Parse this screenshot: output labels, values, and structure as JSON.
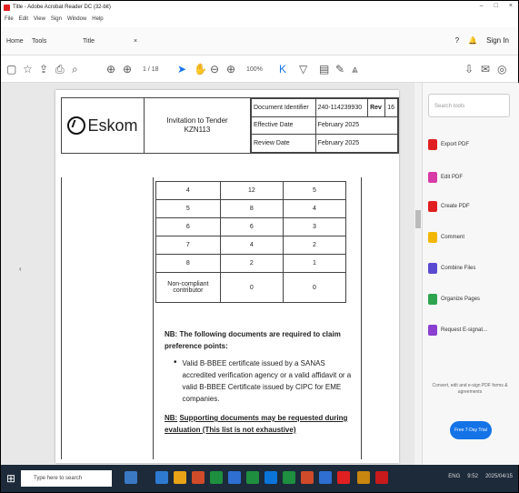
{
  "window": {
    "title": "Title - Adobe Acrobat Reader DC (32-bit)",
    "controls": [
      "–",
      "□",
      "×"
    ]
  },
  "menu": [
    "File",
    "Edit",
    "View",
    "Sign",
    "Window",
    "Help"
  ],
  "tabs": {
    "home": "Home",
    "tools": "Tools",
    "doc": "Title"
  },
  "tabbar_right": {
    "help": "?",
    "bell": "🔔",
    "signin": "Sign In"
  },
  "toolbar": {
    "zoom": "100%",
    "page": "1 / 18"
  },
  "document": {
    "logo_text": "Eskom",
    "title_line1": "Invitation to Tender",
    "title_line2": "KZN113",
    "header_rows": [
      {
        "label": "Document Identifier",
        "value": "240-114239930",
        "rev_label": "Rev",
        "rev_value": "16"
      },
      {
        "label": "Effective Date",
        "value": "February 2025"
      },
      {
        "label": "Review Date",
        "value": "February 2025"
      }
    ],
    "table_rows": [
      [
        "4",
        "12",
        "5"
      ],
      [
        "5",
        "8",
        "4"
      ],
      [
        "6",
        "6",
        "3"
      ],
      [
        "7",
        "4",
        "2"
      ],
      [
        "8",
        "2",
        "1"
      ],
      [
        "Non-compliant contributor",
        "0",
        "0"
      ]
    ],
    "nb_heading": "NB: The following documents are required to claim preference points:",
    "bullet": "Valid B-BBEE certificate issued by a SANAS accredited verification agency or a valid affidavit or a valid B-BBEE Certificate issued by CIPC for EME companies.",
    "nb2_label": "NB:",
    "nb2_text": "Supporting documents may be requested during evaluation (This list is not exhaustive)"
  },
  "right_panel": {
    "search_placeholder": "Search tools",
    "items": [
      {
        "label": "Export PDF",
        "color": "#e02020"
      },
      {
        "label": "Edit PDF",
        "color": "#d83ba6"
      },
      {
        "label": "Create PDF",
        "color": "#e02020"
      },
      {
        "label": "Comment",
        "color": "#f2b705"
      },
      {
        "label": "Combine Files",
        "color": "#5a4ad1"
      },
      {
        "label": "Organize Pages",
        "color": "#2ea44f"
      },
      {
        "label": "Request E-signat...",
        "color": "#8a3fd1"
      }
    ],
    "note": "Convert, edit and e-sign PDF forms & agreements",
    "trial_button": "Free 7-Day Trial"
  },
  "taskbar": {
    "search_placeholder": "Type here to search",
    "tray_text": "ENG",
    "time": "9:52",
    "date": "2025/04/15"
  }
}
